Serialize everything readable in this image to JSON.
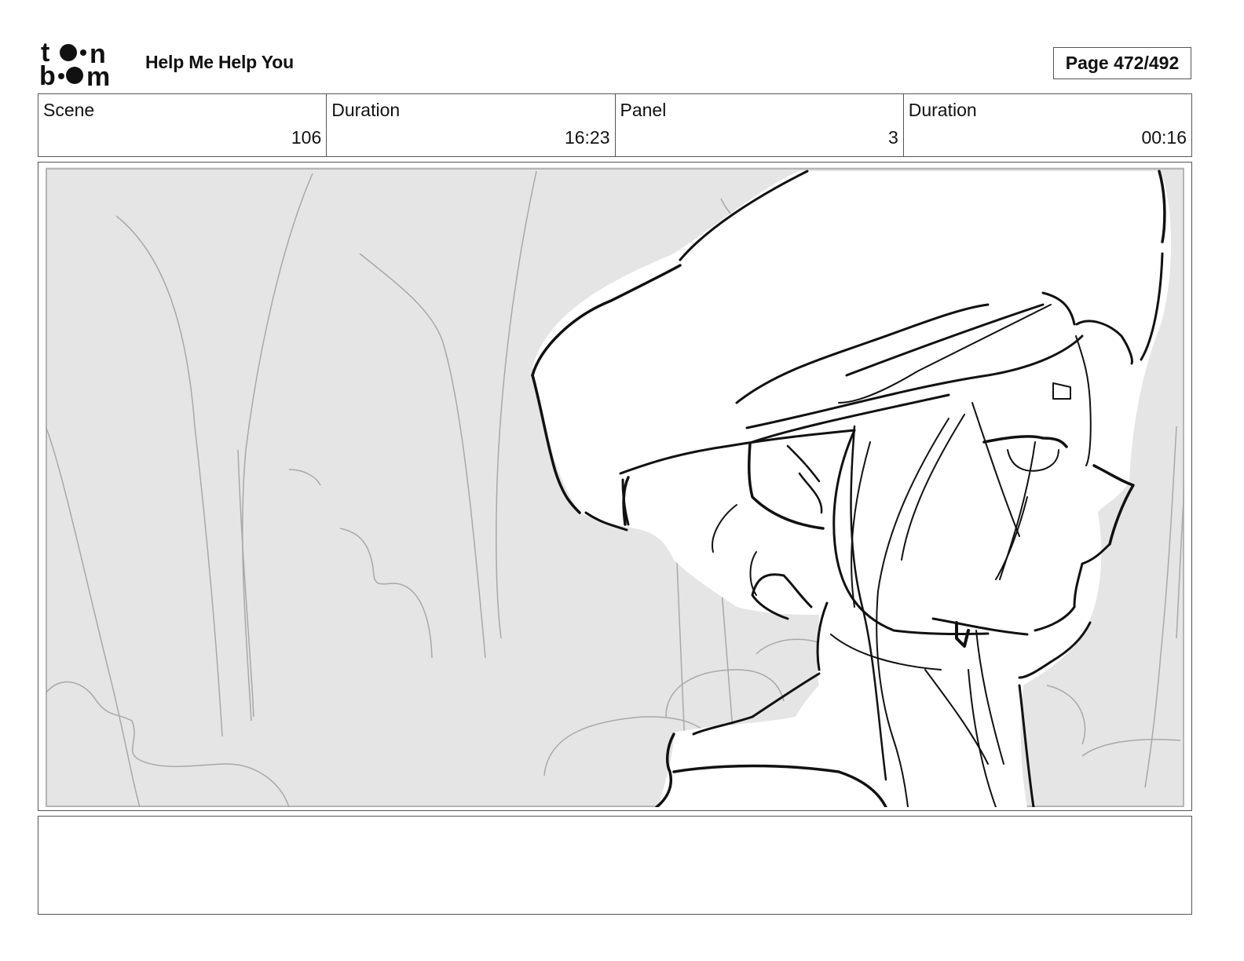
{
  "header": {
    "logo": {
      "name": "toon boom",
      "icon": "toon-boom-logo"
    },
    "project_title": "Help Me Help You",
    "page_label": "Page 472/492"
  },
  "info_row": [
    {
      "label": "Scene",
      "value": "106"
    },
    {
      "label": "Duration",
      "value": "16:23"
    },
    {
      "label": "Panel",
      "value": "3"
    },
    {
      "label": "Duration",
      "value": "00:16"
    }
  ],
  "panel": {
    "description_icon": "storyboard-sketch-character-with-hat-in-forest",
    "background_color": "#e5e5e5",
    "line_color": "#111111",
    "background_line_color": "#a8a8a8"
  },
  "notes": {
    "text": ""
  }
}
